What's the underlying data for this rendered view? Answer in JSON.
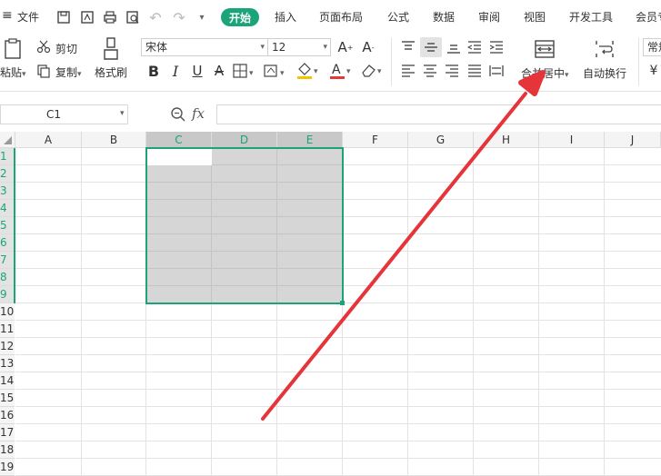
{
  "menu": {
    "hamburger_icon": "≡",
    "file_label": "文件",
    "tabs": [
      "开始",
      "插入",
      "页面布局",
      "公式",
      "数据",
      "审阅",
      "视图",
      "开发工具",
      "会员专"
    ]
  },
  "ribbon": {
    "paste_label": "粘贴",
    "cut_label": "剪切",
    "copy_label": "复制",
    "format_painter_label": "格式刷",
    "font_name": "宋体",
    "font_size": "12",
    "merge_center_label": "合并居中",
    "wrap_text_label": "自动换行",
    "number_format_label": "常规"
  },
  "formula_bar": {
    "cell_ref": "C1",
    "fx_label": "fx",
    "value": ""
  },
  "sheet": {
    "columns": [
      "A",
      "B",
      "C",
      "D",
      "E",
      "F",
      "G",
      "H",
      "I",
      "J"
    ],
    "rows": [
      "1",
      "2",
      "3",
      "4",
      "5",
      "6",
      "7",
      "8",
      "9",
      "10",
      "11",
      "12",
      "13",
      "14",
      "15",
      "16",
      "17",
      "18",
      "19"
    ],
    "selection": "C1:E9"
  },
  "colors": {
    "accent": "#1ba37a",
    "selection_fill": "#d6d6d6",
    "arrow": "#e5353a"
  }
}
